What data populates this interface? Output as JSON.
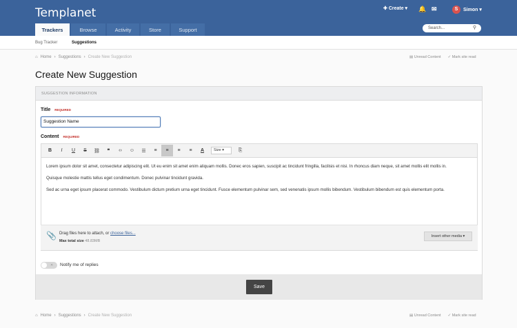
{
  "header": {
    "logo": "Templanet",
    "create": "Create",
    "user_initial": "S",
    "user_name": "Simon",
    "search_placeholder": "Search..."
  },
  "nav": {
    "tabs": [
      "Trackers",
      "Browse",
      "Activity",
      "Store",
      "Support"
    ]
  },
  "subnav": {
    "items": [
      "Bug Tracker",
      "Suggestions"
    ]
  },
  "breadcrumb": {
    "home": "Home",
    "parent": "Suggestions",
    "current": "Create New Suggestion",
    "sep": "›"
  },
  "links": {
    "unread": "Unread Content",
    "mark_read": "Mark site read"
  },
  "page_title": "Create New Suggestion",
  "form": {
    "panel_title": "SUGGESTION INFORMATION",
    "title_label": "Title",
    "content_label": "Content",
    "required": "REQUIRED",
    "title_value": "Suggestion Name",
    "size_label": "Size",
    "paragraphs": [
      "Lorem ipsum dolor sit amet, consectetur adipiscing elit. Ut eu enim sit amet enim aliquam mollis. Donec eros sapien, suscipit ac tincidunt fringilla, facilisis et nisi. In rhoncus diam neque, sit amet mollis elit mollis in.",
      "Quisque molestie mattis tellus eget condimentum. Donec pulvinar tincidunt gravida.",
      "Sed ac urna eget ipsum placerat commodo. Vestibulum dictum pretium urna eget tincidunt. Fusce elementum pulvinar sem, sed venenatis ipsum mollis bibendum. Vestibulum bibendum est quis elementum porta."
    ],
    "attach_text": "Drag files here to attach, or ",
    "attach_link": "choose files...",
    "max_label": "Max total size",
    "max_value": "48.83MB",
    "insert_media": "Insert other media ▾",
    "notify_label": "Notify me of replies",
    "save": "Save"
  },
  "colors": {
    "header": "#3b639b",
    "accent": "#4a77b5",
    "required": "#c3312b"
  }
}
